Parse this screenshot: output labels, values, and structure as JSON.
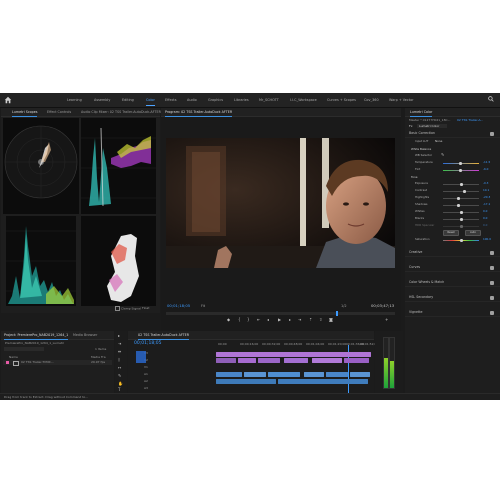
{
  "workspaces": [
    "Learning",
    "Assembly",
    "Editing",
    "Color",
    "Effects",
    "Audio",
    "Graphics",
    "Libraries",
    "Mr_SCHOTT",
    "I.I.C_Workspace",
    "Curves + Scopes",
    "Cov_360",
    "Warp + Vector"
  ],
  "active_workspace_index": 3,
  "scopes_panel": {
    "tabs": [
      "Lumetri Scopes",
      "Effect Controls",
      "Audio Clip Mixer: 02 TSS Trailer-AutoDuck-AFTER"
    ],
    "clamp_signal": "Clamp Signal",
    "float_label": "Float"
  },
  "program": {
    "tab": "Program: 02 TSS Trailer-AutoDuck AFTER",
    "timecode_in": "00;01;18;05",
    "fit": "Fit",
    "quality": "1/2",
    "duration": "00;03;47;13"
  },
  "project": {
    "tabs": [
      "Project: PremierePro_NAB2019_1264_1",
      "Media Browser"
    ],
    "path": "PremierePro_NAB2019_1264_1_Lumetri",
    "items_count": "1 Items",
    "col_name": "Name",
    "col_fps": "Media Fra",
    "row_name": "02 TSS Trailer-TVMX...",
    "row_fps": "29.97 fps"
  },
  "timeline": {
    "tab": "02 TSS Trailer-AutoDuck AFTER",
    "timecode": "00;01;18;05",
    "ruler": [
      "00;00",
      "00;00;16;00",
      "00;00;32;00",
      "00;00;48;00",
      "00;01;04;00",
      "00;01;20;00",
      "00;01;36;00",
      "00;01;52;00"
    ],
    "tracks": [
      "V3",
      "V2",
      "V1",
      "A1",
      "A2",
      "A3"
    ]
  },
  "lumetri_color": {
    "tab": "Lumetri Color",
    "master": "Master * 01277H021_18C...",
    "seq": "02 TSS Trailer-A...",
    "fx": "Fx",
    "fx_value": "Lumetri Color",
    "basic_correction": "Basic Correction",
    "input_lut": "Input LUT",
    "input_lut_value": "None",
    "white_balance": "White Balance",
    "wb_selector": "WB Selector",
    "temperature": "Temperature",
    "temperature_value": "-11.5",
    "tint": "Tint",
    "tint_value": "-6.0",
    "tone": "Tone",
    "exposure": "Exposure",
    "exposure_value": "-0.3",
    "contrast": "Contrast",
    "contrast_value": "10.1",
    "highlights": "Highlights",
    "highlights_value": "-20.3",
    "shadows": "Shadows",
    "shadows_value": "-17.1",
    "whites": "Whites",
    "whites_value": "0.0",
    "blacks": "Blacks",
    "blacks_value": "0.0",
    "hdr_specular": "HDR Specular",
    "hdr_value": "0.0",
    "reset": "Reset",
    "auto": "Auto",
    "saturation": "Saturation",
    "saturation_value": "100.0",
    "sections": [
      "Creative",
      "Curves",
      "Color Wheels & Match",
      "HSL Secondary",
      "Vignette"
    ]
  },
  "status": "Drag from track to Extract. Drag without Command to..."
}
